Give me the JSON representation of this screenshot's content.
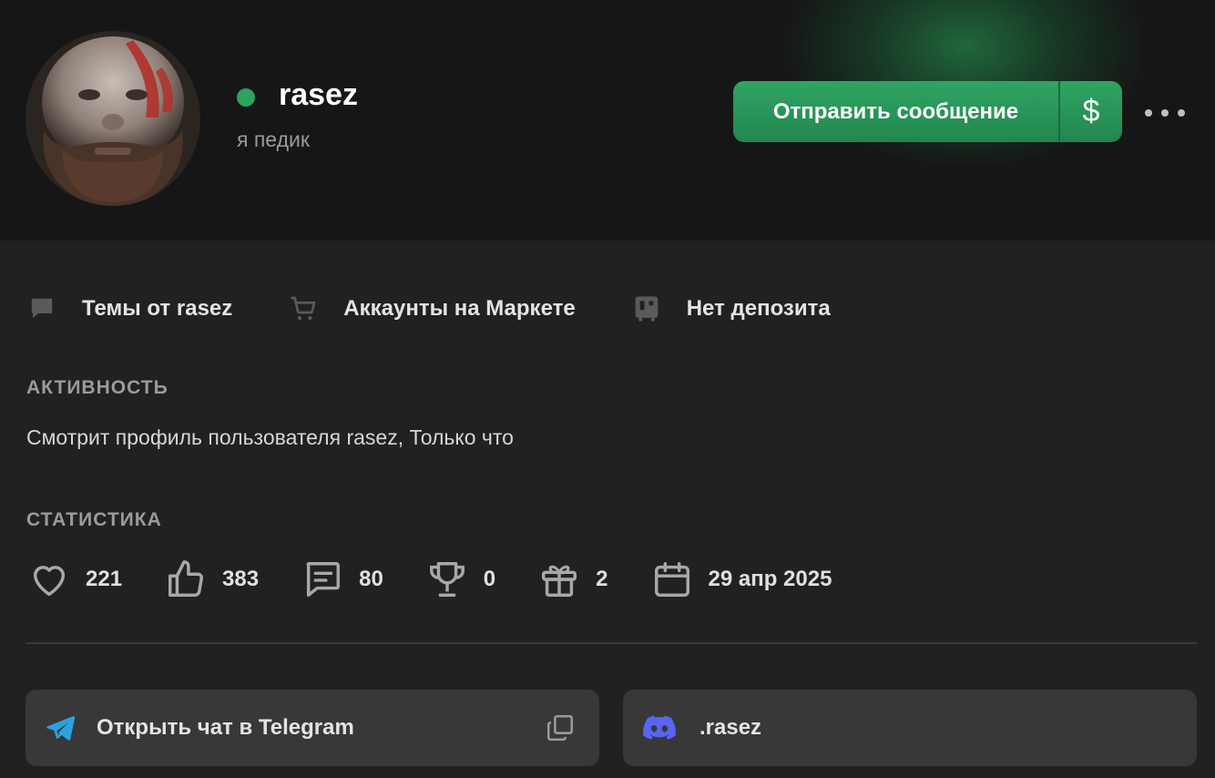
{
  "profile": {
    "username": "rasez",
    "title": "я педик",
    "online": true,
    "status_color": "#2ba35c"
  },
  "actions": {
    "send_message_label": "Отправить сообщение",
    "money_symbol": "$"
  },
  "links": [
    {
      "label": "Темы от rasez",
      "icon": "chat-bubble-icon"
    },
    {
      "label": "Аккаунты на Маркете",
      "icon": "cart-icon"
    },
    {
      "label": "Нет депозита",
      "icon": "deposit-safe-icon"
    }
  ],
  "activity": {
    "heading": "АКТИВНОСТЬ",
    "text": "Смотрит профиль пользователя rasez, Только что"
  },
  "statistics": {
    "heading": "СТАТИСТИКА",
    "items": [
      {
        "icon": "heart-icon",
        "value": "221"
      },
      {
        "icon": "thumbs-up-icon",
        "value": "383"
      },
      {
        "icon": "messages-icon",
        "value": "80"
      },
      {
        "icon": "trophy-icon",
        "value": "0"
      },
      {
        "icon": "gift-icon",
        "value": "2"
      },
      {
        "icon": "calendar-icon",
        "value": "29 апр 2025"
      }
    ]
  },
  "contacts": {
    "telegram_label": "Открыть чат в Telegram",
    "discord_label": ".rasez"
  },
  "colors": {
    "accent_green": "#2fa563",
    "background": "#212121",
    "telegram_blue": "#2aa3e0",
    "discord_purple": "#5865f2"
  }
}
